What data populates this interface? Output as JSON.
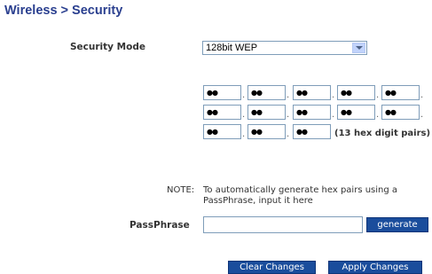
{
  "page": {
    "title": "Wireless > Security"
  },
  "security_mode": {
    "label": "Security Mode",
    "selected": "128bit WEP"
  },
  "keys": {
    "row1": [
      "●●",
      "●●",
      "●●",
      "●●",
      "●●"
    ],
    "row2": [
      "●●",
      "●●",
      "●●",
      "●●",
      "●●"
    ],
    "row3": [
      "●●",
      "●●",
      "●●"
    ],
    "hint": "(13 hex digit pairs)"
  },
  "note": {
    "label": "NOTE:",
    "text": "To automatically generate hex pairs using a PassPhrase, input it here"
  },
  "passphrase": {
    "label": "PassPhrase",
    "value": "",
    "generate_label": "generate"
  },
  "actions": {
    "clear_label": "Clear Changes",
    "apply_label": "Apply Changes"
  }
}
